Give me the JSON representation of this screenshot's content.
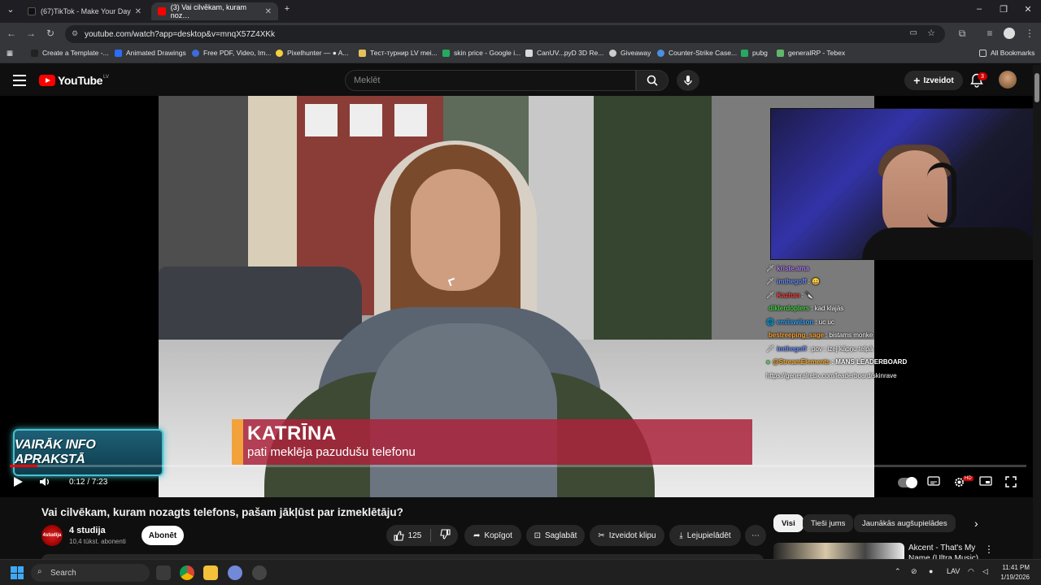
{
  "browser": {
    "tabs": [
      {
        "label": "(67)TikTok - Make Your Day",
        "active": false
      },
      {
        "label": "(3) Vai cilvēkam, kuram noz…",
        "active": true
      }
    ],
    "url": "youtube.com/watch?app=desktop&v=mnqX57Z4XKk",
    "bookmarks": [
      "Create a Template -...",
      "Animated Drawings",
      "Free PDF, Video, Im...",
      "Pixelhunter — ● A...",
      "Тест-турнир LV mei...",
      "skin price - Google i...",
      "CanUV...pyD 3D Re...",
      "Giveaway",
      "Counter-Strike Case...",
      "pubg",
      "generalRP - Tebex"
    ],
    "all_bookmarks_label": "All Bookmarks"
  },
  "youtube": {
    "logo_text": "YouTube",
    "country_code": "LV",
    "search_placeholder": "Meklēt",
    "create_label": "Izveidot",
    "notification_count": "3"
  },
  "video": {
    "lower_third_name": "KATRĪNA",
    "lower_third_sub": "pati meklēja pazudušu telefonu",
    "promo_label": "VAIRĀK INFO APRAKSTĀ",
    "time_current": "0:12",
    "time_total": "7:23",
    "time_display": "0:12 / 7:23",
    "progress_fraction": 0.027,
    "chat": [
      {
        "icon": "🗡",
        "user": "kriste.ama",
        "msg": "",
        "color": "#b57cff"
      },
      {
        "icon": "🗡",
        "user": "imthegoff",
        "msg": ": 😀",
        "color": "#6a8cff"
      },
      {
        "icon": "🗡",
        "user": "Kazhan",
        "msg": ": 🔪",
        "color": "#ff3b3b"
      },
      {
        "icon": "",
        "user": "diklerdoplers",
        "msg": ": kad klajās",
        "color": "#43d743"
      },
      {
        "icon": "🌐",
        "user": "emilswilson",
        "msg": ": uc uc",
        "color": "#2ea4ff"
      },
      {
        "icon": "",
        "user": "bestreeping_sage",
        "msg": ": bistams monke",
        "color": "#ffa12b"
      },
      {
        "icon": "🗡",
        "user": "imthegoff",
        "msg": ": pov : izej kāpņu telpā",
        "color": "#6a8cff"
      },
      {
        "icon": "●",
        "user": "@StreamElements",
        "msg": ": MANS LEADERBOARD",
        "color": "#ffb02e"
      },
      {
        "icon": "",
        "user": "",
        "msg": "https://generalrebx.com/leaderboard/skinrave",
        "color": "#ffffff"
      }
    ]
  },
  "below": {
    "title": "Vai cilvēkam, kuram nozagts telefons, pašam jākļūst par izmeklētāju?",
    "channel_name": "4 studija",
    "channel_avatar_text": "4studija",
    "subscribers": "10,4 tūkst. abonenti",
    "subscribe_label": "Abonēt",
    "likes": "125",
    "share_label": "Kopīgot",
    "save_label": "Saglabāt",
    "clip_label": "Izveidot klipu",
    "download_label": "Lejupielādēt"
  },
  "sidebar": {
    "chips": [
      "Visi",
      "Tieši jums",
      "Jaunākās augšupielādes"
    ],
    "rec_title": "Akcent - That's My Name (Ultra Music)"
  },
  "taskbar": {
    "search_placeholder": "Search",
    "lang": "LAV",
    "time": "11:41 PM",
    "date": "1/19/2026"
  },
  "colors": {
    "yt_red": "#ff0000",
    "lower_third_bg": "#aa233c",
    "lower_third_accent": "#f2a23a",
    "promo_border": "#47c1cf"
  }
}
